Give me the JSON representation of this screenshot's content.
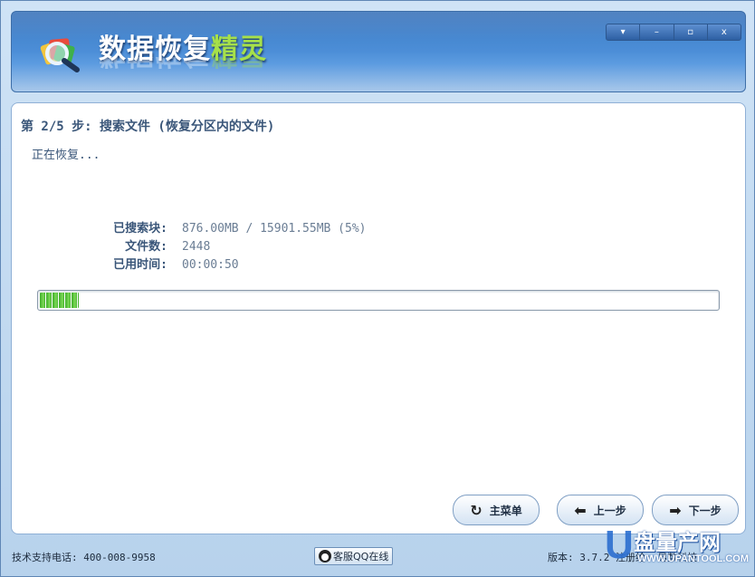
{
  "app": {
    "title_main": "数据恢复",
    "title_accent": "精灵"
  },
  "window_controls": {
    "menu": "▾",
    "minimize": "–",
    "maximize": "▫",
    "close": "x"
  },
  "step": {
    "title": "第 2/5 步: 搜索文件 (恢复分区内的文件)",
    "status": "正在恢复..."
  },
  "info": [
    {
      "label": "已搜索块:",
      "value": "876.00MB / 15901.55MB (5%)"
    },
    {
      "label": "文件数:",
      "value": "2448"
    },
    {
      "label": "已用时间:",
      "value": "00:00:50"
    }
  ],
  "progress": {
    "fraction": 0.057
  },
  "buttons": {
    "main_menu": {
      "label": "主菜单",
      "icon": "refresh-icon"
    },
    "prev": {
      "label": "上一步",
      "icon": "arrow-left-icon"
    },
    "next": {
      "label": "下一步",
      "icon": "arrow-right-icon"
    }
  },
  "footer": {
    "support": "技术支持电话: 400-008-9958",
    "qq_button": "客服QQ在线",
    "version": "版本: 3.7.2  注册给: 易数科技"
  },
  "watermark": {
    "letter": "U",
    "cn": "盘量产网",
    "en": "WWW.UPANTOOL.COM"
  },
  "colors": {
    "accent_green": "#a6e04a",
    "header_blue": "#3d82cf",
    "progress_green": "#3fae2a",
    "text_blue": "#3a5679"
  }
}
